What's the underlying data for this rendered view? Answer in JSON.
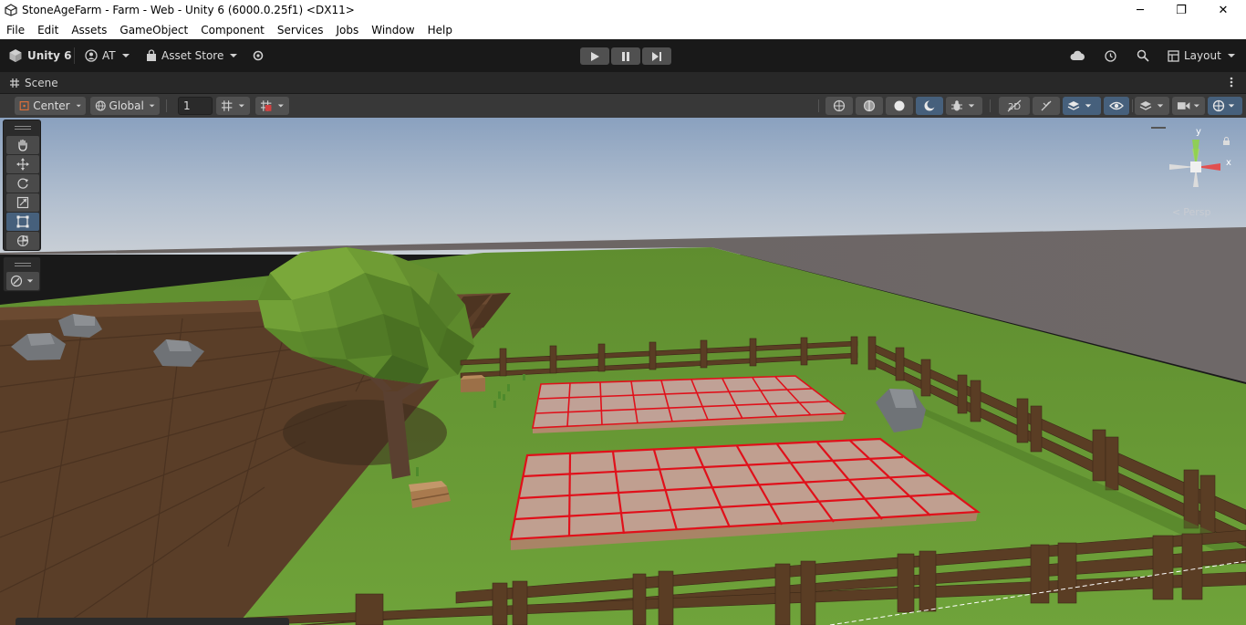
{
  "window": {
    "title": "StoneAgeFarm - Farm - Web - Unity 6 (6000.0.25f1) <DX11>",
    "minimize": "─",
    "restore": "❐",
    "close": "✕"
  },
  "menu": [
    "File",
    "Edit",
    "Assets",
    "GameObject",
    "Component",
    "Services",
    "Jobs",
    "Window",
    "Help"
  ],
  "toolbar": {
    "unity_label": "Unity 6",
    "account_label": "AT",
    "asset_store_label": "Asset Store",
    "layout_label": "Layout"
  },
  "scene_tab": {
    "label": "Scene"
  },
  "scene_toolbar": {
    "pivot_label": "Center",
    "space_label": "Global",
    "grid_value": "1"
  },
  "gizmo": {
    "y_label": "y",
    "x_label": "x",
    "persp_label": "Persp"
  },
  "colors": {
    "sky_top": "#8fa6c3",
    "grass": "#6a9a35",
    "soil": "#5a3e28",
    "fence": "#5a3d24",
    "grid_red": "#e0101a",
    "accent_blue": "#46607c"
  }
}
